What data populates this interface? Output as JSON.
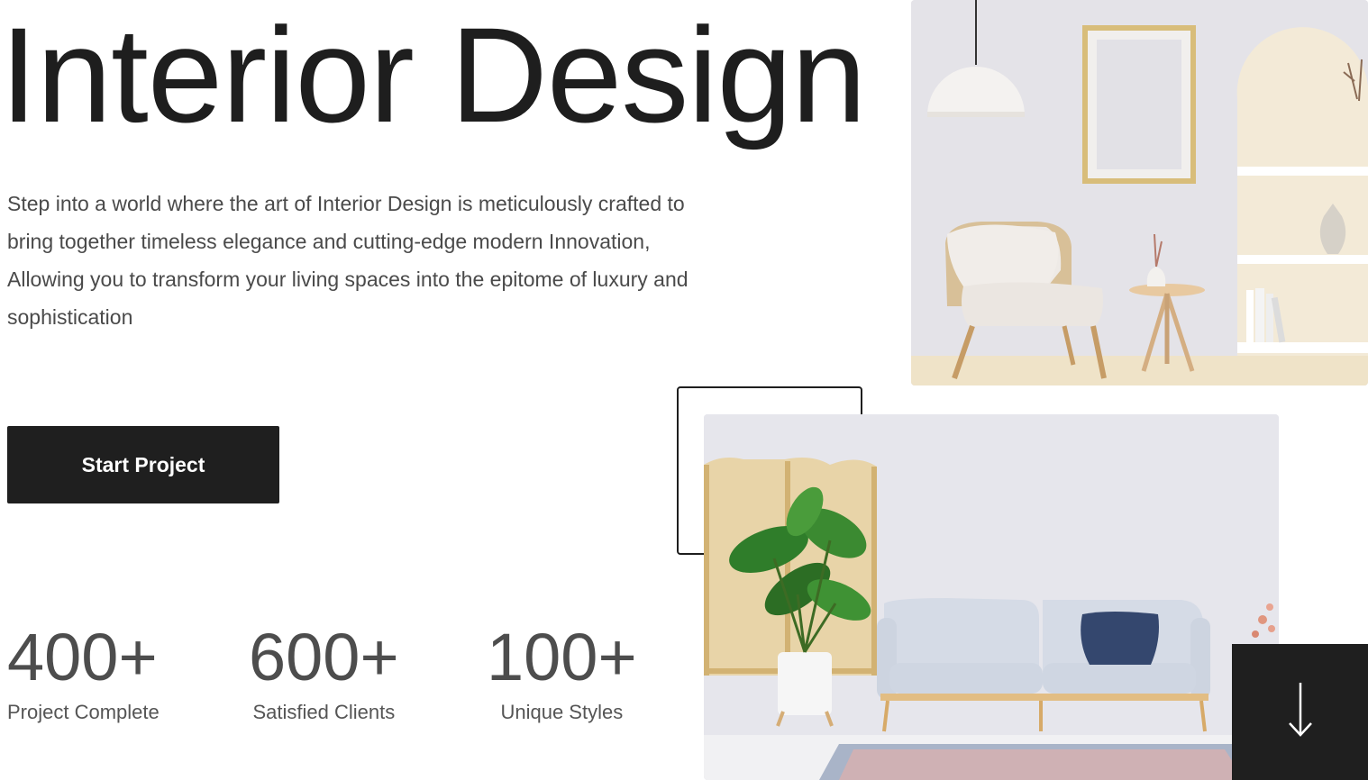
{
  "hero": {
    "title": "Interior Design",
    "description": "Step into a world where the art of Interior Design is meticulously crafted to bring together timeless elegance and cutting-edge modern Innovation, Allowing you to transform your living spaces into the epitome of luxury and sophistication",
    "cta_label": "Start Project"
  },
  "stats": [
    {
      "value": "400+",
      "label": "Project Complete"
    },
    {
      "value": "600+",
      "label": "Satisfied Clients"
    },
    {
      "value": "100+",
      "label": "Unique Styles"
    }
  ],
  "images": {
    "top": "armchair-room-photo",
    "bottom": "sofa-room-photo"
  },
  "scroll_icon": "arrow-down-icon",
  "colors": {
    "text": "#1e1e1e",
    "muted": "#4a4a4a",
    "button_bg": "#1f1f1f",
    "button_text": "#ffffff"
  }
}
